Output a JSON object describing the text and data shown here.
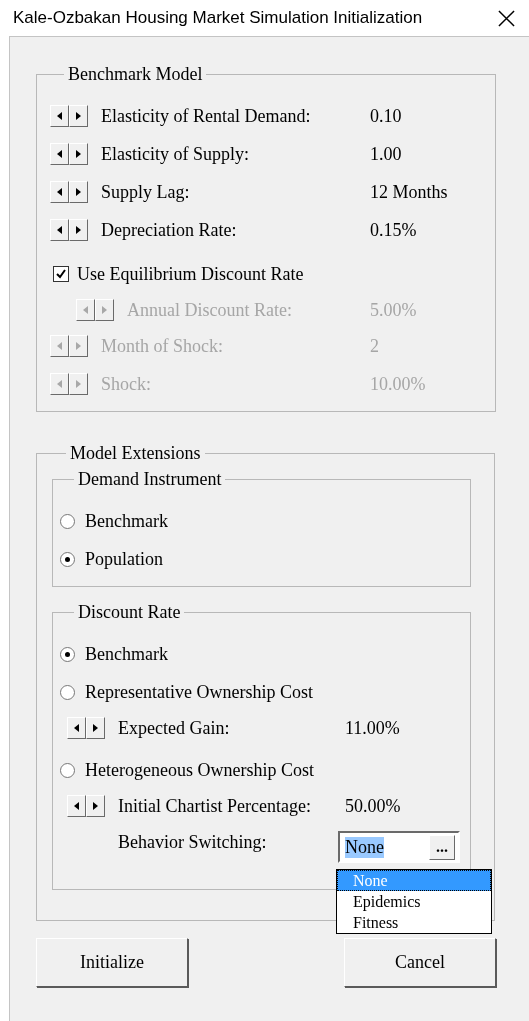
{
  "window": {
    "title": "Kale-Ozbakan Housing Market Simulation Initialization"
  },
  "benchmark_model": {
    "title": "Benchmark Model",
    "items": [
      {
        "kind": "spinner",
        "label": "Elasticity of Rental Demand:",
        "value": "0.10",
        "disabled": false
      },
      {
        "kind": "spinner",
        "label": "Elasticity of Supply:",
        "value": "1.00",
        "disabled": false
      },
      {
        "kind": "spinner",
        "label": "Supply Lag:",
        "value": "12 Months",
        "disabled": false
      },
      {
        "kind": "spinner",
        "label": "Depreciation Rate:",
        "value": "0.15%",
        "disabled": false
      },
      {
        "kind": "checkbox",
        "label": "Use Equilibrium Discount Rate",
        "checked": true,
        "children": [
          {
            "kind": "spinner",
            "label": "Annual Discount Rate:",
            "value": "5.00%",
            "disabled": true
          }
        ]
      },
      {
        "kind": "spinner",
        "label": "Month of Shock:",
        "value": "2",
        "disabled": true
      },
      {
        "kind": "spinner",
        "label": "Shock:",
        "value": "10.00%",
        "disabled": true
      }
    ]
  },
  "model_extensions": {
    "title": "Model Extensions",
    "demand_instrument": {
      "title": "Demand Instrument",
      "options": [
        {
          "label": "Benchmark",
          "selected": false
        },
        {
          "label": "Population",
          "selected": true
        }
      ]
    },
    "discount_rate": {
      "title": "Discount Rate",
      "options": [
        {
          "label": "Benchmark",
          "selected": true
        },
        {
          "label": "Representative Ownership Cost",
          "selected": false,
          "children": [
            {
              "kind": "spinner",
              "label": "Expected Gain:",
              "value": "11.00%",
              "disabled": false
            }
          ]
        },
        {
          "label": "Heterogeneous Ownership Cost",
          "selected": false,
          "children": [
            {
              "kind": "spinner",
              "label": "Initial Chartist Percentage:",
              "value": "50.00%",
              "disabled": false
            },
            {
              "kind": "dropdown",
              "label": "Behavior Switching:",
              "value": "None",
              "button": "...",
              "expanded": true,
              "options": [
                {
                  "label": "None",
                  "selected": true
                },
                {
                  "label": "Epidemics",
                  "selected": false
                },
                {
                  "label": "Fitness",
                  "selected": false
                }
              ]
            }
          ]
        }
      ]
    }
  },
  "buttons": [
    {
      "label": "Initialize"
    },
    {
      "label": "Cancel"
    }
  ]
}
